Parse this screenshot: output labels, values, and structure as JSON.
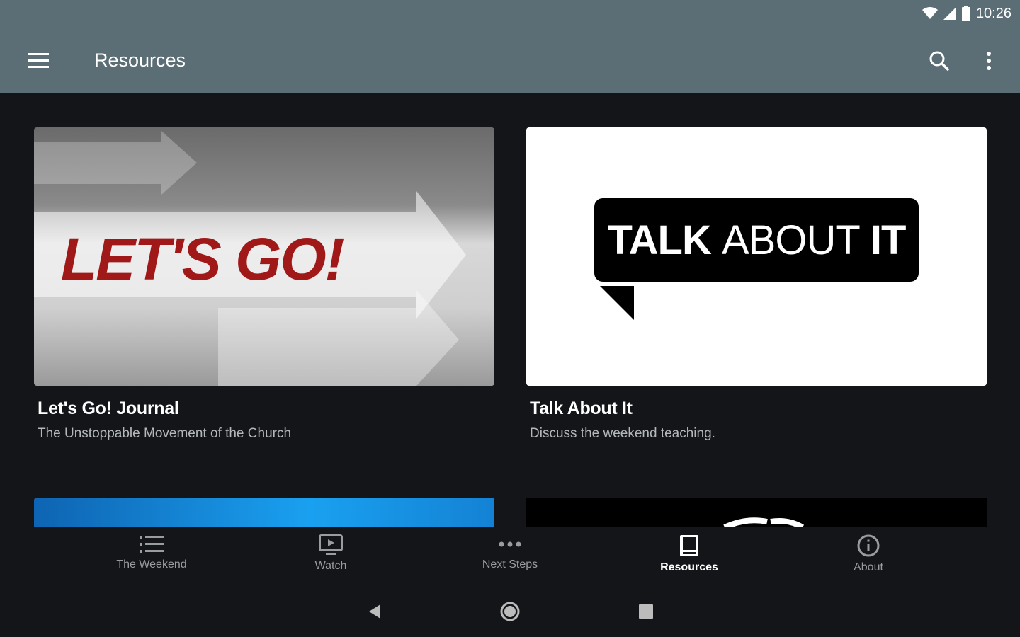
{
  "status": {
    "time": "10:26"
  },
  "toolbar": {
    "title": "Resources"
  },
  "cards": [
    {
      "title": "Let's Go! Journal",
      "subtitle": "The Unstoppable Movement of the Church",
      "image_text": "LET'S GO!"
    },
    {
      "title": "Talk About It",
      "subtitle": "Discuss the weekend teaching.",
      "image_text_bold_1": "TALK",
      "image_text_light": "ABOUT",
      "image_text_bold_2": "IT"
    }
  ],
  "nav": {
    "items": [
      {
        "label": "The Weekend",
        "icon": "list-icon"
      },
      {
        "label": "Watch",
        "icon": "tv-icon"
      },
      {
        "label": "Next Steps",
        "icon": "more-horizontal-icon"
      },
      {
        "label": "Resources",
        "icon": "book-icon",
        "active": true
      },
      {
        "label": "About",
        "icon": "info-icon"
      }
    ]
  },
  "colors": {
    "appbar": "#5c6e75",
    "background": "#131518",
    "accent_red": "#a01818"
  }
}
